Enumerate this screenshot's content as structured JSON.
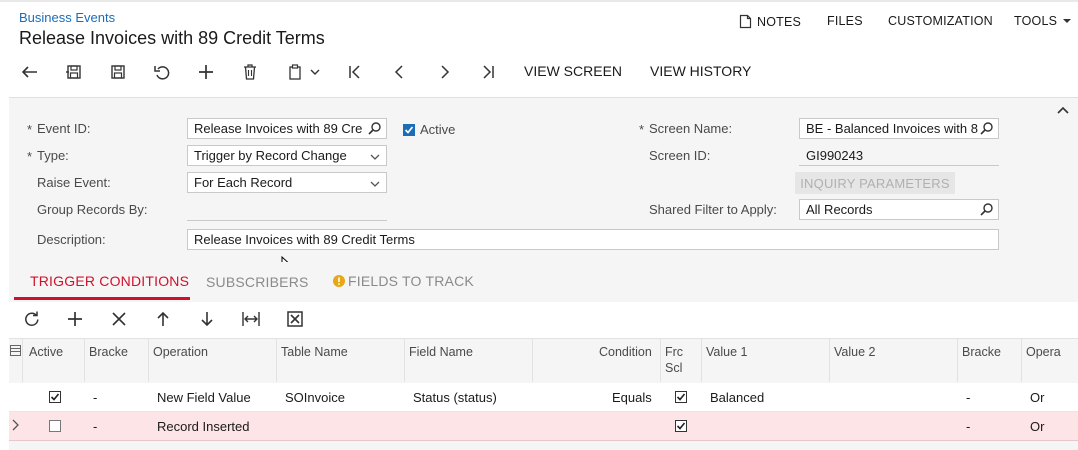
{
  "breadcrumb": "Business Events",
  "title": "Release Invoices with 89 Credit Terms",
  "topnav": {
    "notes": "NOTES",
    "files": "FILES",
    "customization": "CUSTOMIZATION",
    "tools": "TOOLS"
  },
  "toolbar": {
    "view_screen": "VIEW SCREEN",
    "view_history": "VIEW HISTORY"
  },
  "form": {
    "event_id_label": "Event ID:",
    "event_id_value": "Release Invoices with 89 Cre",
    "active_label": "Active",
    "type_label": "Type:",
    "type_value": "Trigger by Record Change",
    "raise_event_label": "Raise Event:",
    "raise_event_value": "For Each Record",
    "group_records_label": "Group Records By:",
    "description_label": "Description:",
    "description_value": "Release Invoices with 89 Credit Terms",
    "screen_name_label": "Screen Name:",
    "screen_name_value": "BE - Balanced Invoices with 8",
    "screen_id_label": "Screen ID:",
    "screen_id_value": "GI990243",
    "inquiry_parameters": "INQUIRY PARAMETERS",
    "shared_filter_label": "Shared Filter to Apply:",
    "shared_filter_value": "All Records",
    "required_mark": "*"
  },
  "tabs": {
    "trigger_conditions": "TRIGGER CONDITIONS",
    "subscribers": "SUBSCRIBERS",
    "fields_to_track": "FIELDS TO TRACK"
  },
  "grid": {
    "headers": {
      "active": "Active",
      "bracket": "Bracke",
      "operation": "Operation",
      "table_name": "Table Name",
      "field_name": "Field Name",
      "condition": "Condition",
      "from_schema_1": "Frc",
      "from_schema_2": "Scl",
      "value1": "Value 1",
      "value2": "Value 2",
      "bracket2": "Bracke",
      "operator": "Opera"
    },
    "rows": [
      {
        "active": true,
        "bracket": "-",
        "operation": "New Field Value",
        "table_name": "SOInvoice",
        "field_name": "Status (status)",
        "condition": "Equals",
        "from_schema": true,
        "value1": "Balanced",
        "value2": "",
        "bracket2": "-",
        "operator": "Or"
      },
      {
        "active": false,
        "bracket": "-",
        "operation": "Record Inserted",
        "table_name": "",
        "field_name": "",
        "condition": "",
        "from_schema": true,
        "value1": "",
        "value2": "",
        "bracket2": "-",
        "operator": "Or"
      }
    ]
  },
  "colors": {
    "accent_link": "#1b6db8",
    "active_tab": "#d0112b",
    "selected_row": "#fde4e6"
  }
}
